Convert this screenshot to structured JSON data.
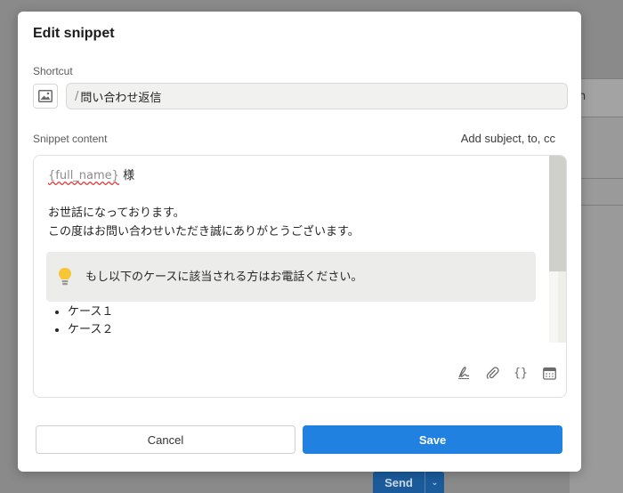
{
  "background": {
    "side_text": "n",
    "send_label": "Send"
  },
  "dialog": {
    "title": "Edit snippet",
    "shortcut_label": "Shortcut",
    "shortcut_prefix": "/",
    "shortcut_value": "問い合わせ返信",
    "content_label": "Snippet content",
    "add_subject_label": "Add subject, to, cc",
    "content": {
      "variable": "{full_name}",
      "greeting_suffix": " 様",
      "line1": "お世話になっております。",
      "line2": "この度はお問い合わせいただき誠にありがとうございます。",
      "callout_text": "もし以下のケースに該当される方はお電話ください。",
      "list_items": [
        "ケース１",
        "ケース２"
      ]
    },
    "toolbar": [
      "signature-icon",
      "attachment-icon",
      "variable-braces-icon",
      "calendar-icon"
    ],
    "cancel_label": "Cancel",
    "save_label": "Save",
    "accent_color": "#2181e1"
  }
}
